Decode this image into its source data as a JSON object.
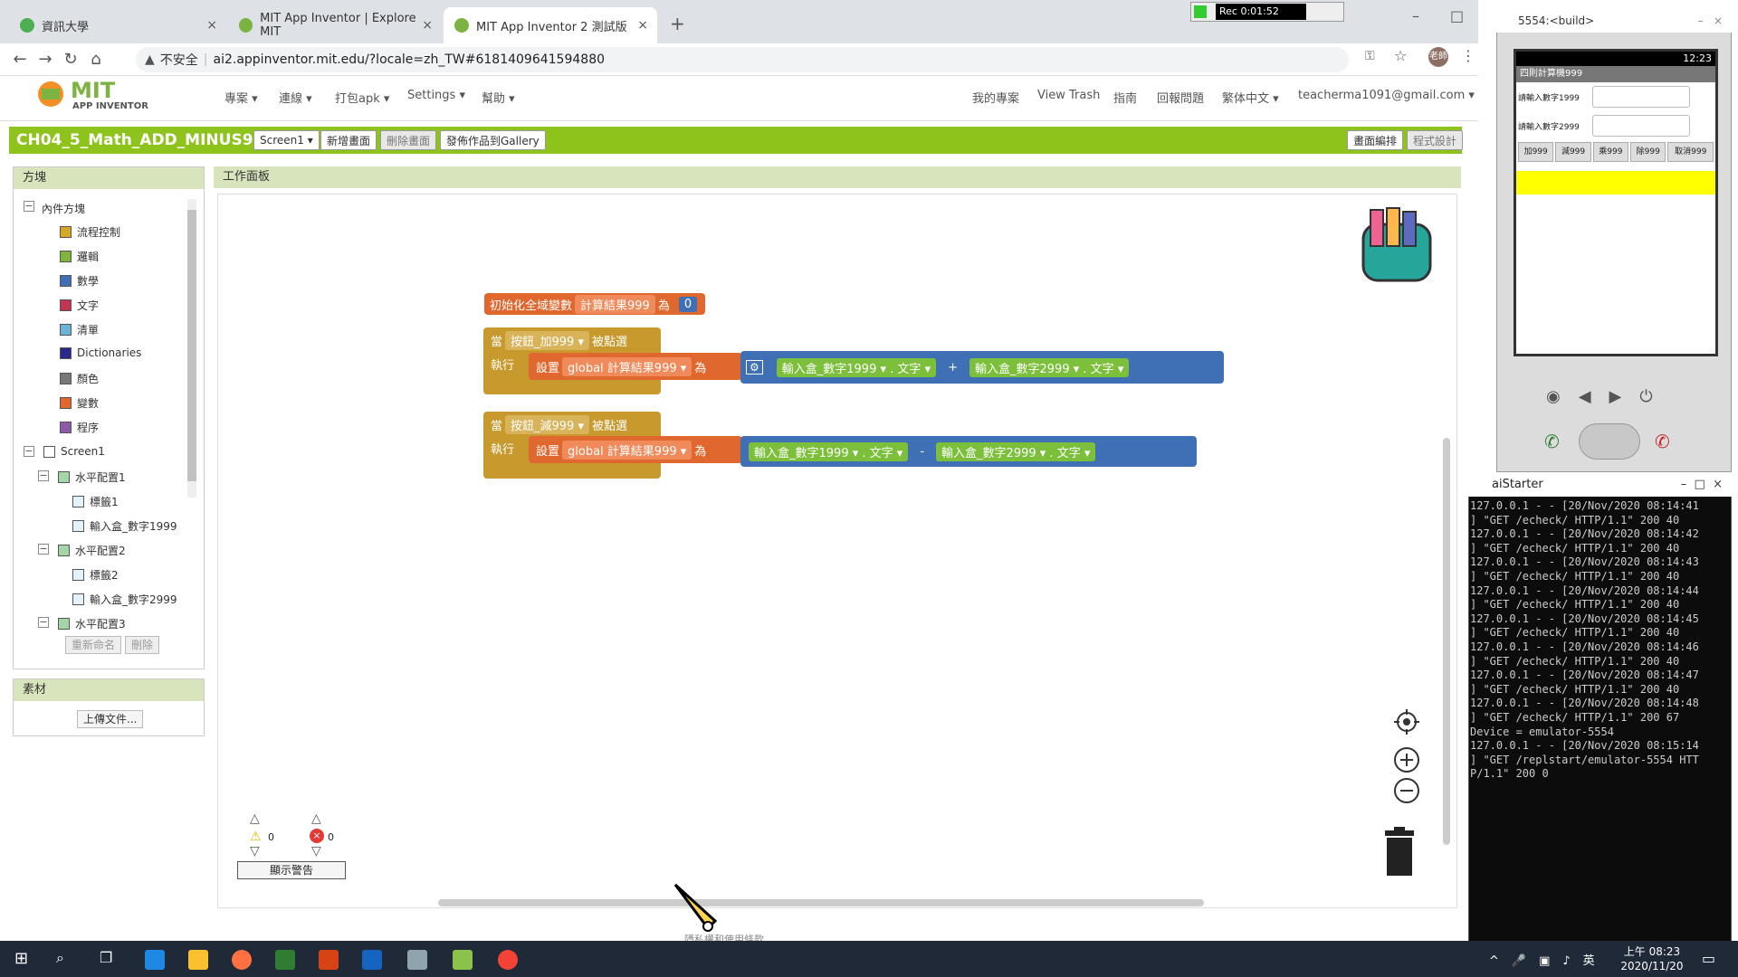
{
  "browser": {
    "tabs": [
      {
        "label": "資訊大學",
        "active": false
      },
      {
        "label": "MIT App Inventor | Explore MIT",
        "active": false
      },
      {
        "label": "MIT App Inventor 2 測試版",
        "active": true
      }
    ],
    "security": "不安全",
    "url": "ai2.appinventor.mit.edu/?locale=zh_TW#6181409641594880",
    "avatar_label": "老師"
  },
  "recorder": {
    "label": "Rec 0:01:52"
  },
  "header": {
    "logo_top": "MIT",
    "logo_bottom": "APP INVENTOR",
    "menus": [
      "專案",
      "連線",
      "打包apk",
      "Settings",
      "幫助"
    ],
    "right_menus": [
      "我的專案",
      "View Trash",
      "指南",
      "回報問題",
      "繁体中文"
    ],
    "account": "teacherma1091@gmail.com"
  },
  "project": {
    "title": "CH04_5_Math_ADD_MINUS999",
    "screen": "Screen1",
    "buttons": [
      "新增畫面",
      "刪除畫面",
      "發佈作品到Gallery"
    ],
    "right_buttons": [
      "畫面編排",
      "程式設計"
    ]
  },
  "blocks_panel": {
    "header": "方塊",
    "builtin": "內件方塊",
    "builtin_items": [
      {
        "label": "流程控制",
        "color": "#d6a827"
      },
      {
        "label": "邏輯",
        "color": "#7fb53b"
      },
      {
        "label": "數學",
        "color": "#3f6fb5"
      },
      {
        "label": "文字",
        "color": "#c43554"
      },
      {
        "label": "清單",
        "color": "#6ab4d8"
      },
      {
        "label": "Dictionaries",
        "color": "#2a2a8a"
      },
      {
        "label": "顏色",
        "color": "#777777"
      },
      {
        "label": "變數",
        "color": "#e0672d"
      },
      {
        "label": "程序",
        "color": "#8e5aa8"
      }
    ],
    "screen_node": "Screen1",
    "components": [
      {
        "label": "水平配置1",
        "level": 1
      },
      {
        "label": "標籤1",
        "level": 2
      },
      {
        "label": "輸入盒_數字1999",
        "level": 2
      },
      {
        "label": "水平配置2",
        "level": 1
      },
      {
        "label": "標籤2",
        "level": 2
      },
      {
        "label": "輸入盒_數字2999",
        "level": 2
      },
      {
        "label": "水平配置3",
        "level": 1
      }
    ],
    "rename_button": "重新命名",
    "delete_button": "刪除"
  },
  "assets_panel": {
    "header": "素材",
    "upload_button": "上傳文件..."
  },
  "workspace": {
    "header": "工作面板",
    "global_init": {
      "label": "初始化全域變數",
      "name": "計算結果999",
      "as": "為",
      "value": "0"
    },
    "event1": {
      "when": "當",
      "component": "按鈕_加999",
      "event": "被點選",
      "do": "執行",
      "set": "設置",
      "var": "global 計算結果999",
      "as": "為",
      "left": "輸入盒_數字1999",
      "left_prop": "文字",
      "op": "+",
      "right": "輸入盒_數字2999",
      "right_prop": "文字"
    },
    "event2": {
      "when": "當",
      "component": "按鈕_減999",
      "event": "被點選",
      "do": "執行",
      "set": "設置",
      "var": "global 計算結果999",
      "as": "為",
      "left": "輸入盒_數字1999",
      "left_prop": "文字",
      "op": "-",
      "right": "輸入盒_數字2999",
      "right_prop": "文字"
    },
    "warnings": "0",
    "errors": "0",
    "show_warnings": "顯示警告",
    "footer_text": "隱私權和使用條款"
  },
  "emulator": {
    "title": "5554:<build>",
    "time": "12:23",
    "app_title": "四則計算機999",
    "field1_label": "請輸入數字1999",
    "field2_label": "請輸入數字2999",
    "buttons": [
      "加999",
      "減999",
      "乘999",
      "除999",
      "取消999"
    ],
    "result_color": "#ffff00"
  },
  "aistarter": {
    "title": "aiStarter",
    "lines": [
      "127.0.0.1 - - [20/Nov/2020 08:14:41",
      "] \"GET /echeck/ HTTP/1.1\" 200 40",
      "127.0.0.1 - - [20/Nov/2020 08:14:42",
      "] \"GET /echeck/ HTTP/1.1\" 200 40",
      "127.0.0.1 - - [20/Nov/2020 08:14:43",
      "] \"GET /echeck/ HTTP/1.1\" 200 40",
      "127.0.0.1 - - [20/Nov/2020 08:14:44",
      "] \"GET /echeck/ HTTP/1.1\" 200 40",
      "127.0.0.1 - - [20/Nov/2020 08:14:45",
      "] \"GET /echeck/ HTTP/1.1\" 200 40",
      "127.0.0.1 - - [20/Nov/2020 08:14:46",
      "] \"GET /echeck/ HTTP/1.1\" 200 40",
      "127.0.0.1 - - [20/Nov/2020 08:14:47",
      "] \"GET /echeck/ HTTP/1.1\" 200 40",
      "127.0.0.1 - - [20/Nov/2020 08:14:48",
      "] \"GET /echeck/ HTTP/1.1\" 200 67",
      "Device = emulator-5554",
      "127.0.0.1 - - [20/Nov/2020 08:15:14",
      "] \"GET /replstart/emulator-5554 HTT",
      "P/1.1\" 200 0"
    ]
  },
  "taskbar": {
    "time": "上午 08:23",
    "date": "2020/11/20",
    "ime": "英"
  },
  "colors": {
    "green": "#8dc31a",
    "event": "#c89a2e",
    "set": "#e0672d",
    "component": "#3f6fb5"
  }
}
